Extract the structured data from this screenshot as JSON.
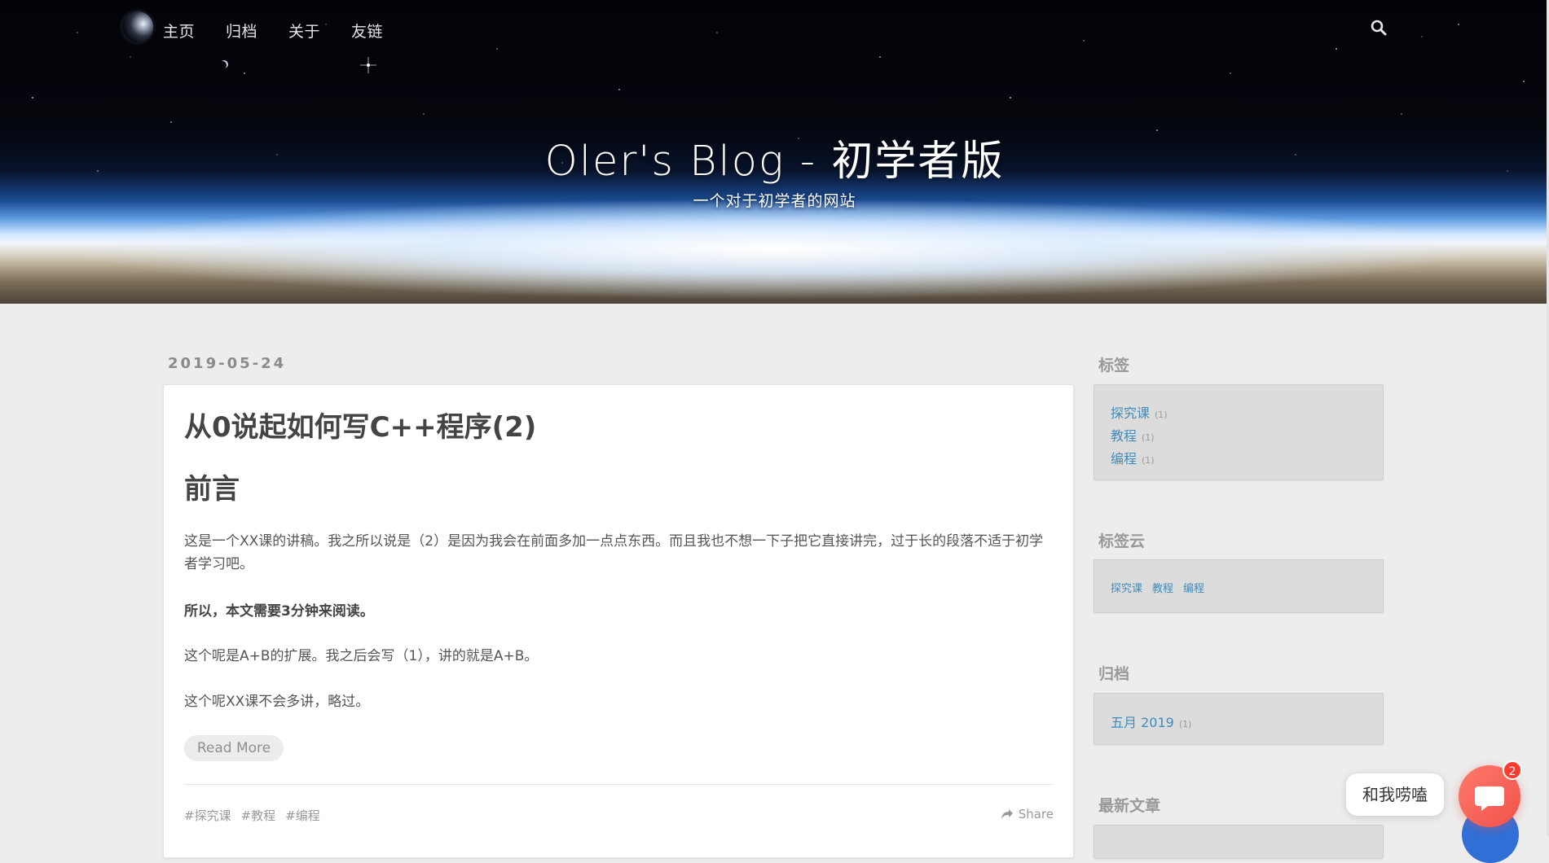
{
  "site": {
    "title": "Oler's Blog - 初学者版",
    "subtitle": "一个对于初学者的网站"
  },
  "nav": {
    "items": [
      {
        "label": "主页"
      },
      {
        "label": "归档"
      },
      {
        "label": "关于"
      },
      {
        "label": "友链"
      }
    ],
    "search_icon": "search-icon"
  },
  "post": {
    "date": "2019-05-24",
    "title": "从0说起如何写C++程序(2)",
    "heading": "前言",
    "paragraphs": [
      "这是一个XX课的讲稿。我之所以说是（2）是因为我会在前面多加一点点东西。而且我也不想一下子把它直接讲完，过于长的段落不适于初学者学习吧。",
      "所以，本文需要3分钟来阅读。",
      "这个呢是A+B的扩展。我之后会写（1），讲的就是A+B。",
      "这个呢XX课不会多讲，略过。"
    ],
    "read_more": "Read More",
    "tags": [
      "#探究课",
      "#教程",
      "#编程"
    ],
    "share": "Share"
  },
  "sidebar": {
    "tags": {
      "title": "标签",
      "items": [
        {
          "name": "探究课",
          "count": "(1)"
        },
        {
          "name": "教程",
          "count": "(1)"
        },
        {
          "name": "编程",
          "count": "(1)"
        }
      ]
    },
    "tag_cloud": {
      "title": "标签云",
      "items": [
        "探究课",
        "教程",
        "编程"
      ]
    },
    "archive": {
      "title": "归档",
      "items": [
        {
          "name": "五月 2019",
          "count": "(1)"
        }
      ]
    },
    "recent": {
      "title": "最新文章"
    }
  },
  "chat": {
    "prompt": "和我唠嗑",
    "badge": "2"
  },
  "colors": {
    "link": "#3c8dbc",
    "chat_accent": "#f0524a",
    "badge": "#ff3b30"
  }
}
